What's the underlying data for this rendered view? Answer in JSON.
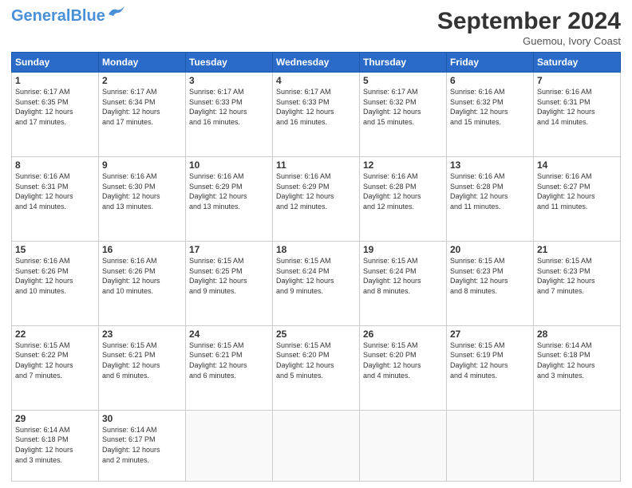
{
  "header": {
    "logo_general": "General",
    "logo_blue": "Blue",
    "month_year": "September 2024",
    "location": "Guemou, Ivory Coast"
  },
  "days_of_week": [
    "Sunday",
    "Monday",
    "Tuesday",
    "Wednesday",
    "Thursday",
    "Friday",
    "Saturday"
  ],
  "weeks": [
    [
      {
        "day": "1",
        "info": "Sunrise: 6:17 AM\nSunset: 6:35 PM\nDaylight: 12 hours\nand 17 minutes."
      },
      {
        "day": "2",
        "info": "Sunrise: 6:17 AM\nSunset: 6:34 PM\nDaylight: 12 hours\nand 17 minutes."
      },
      {
        "day": "3",
        "info": "Sunrise: 6:17 AM\nSunset: 6:33 PM\nDaylight: 12 hours\nand 16 minutes."
      },
      {
        "day": "4",
        "info": "Sunrise: 6:17 AM\nSunset: 6:33 PM\nDaylight: 12 hours\nand 16 minutes."
      },
      {
        "day": "5",
        "info": "Sunrise: 6:17 AM\nSunset: 6:32 PM\nDaylight: 12 hours\nand 15 minutes."
      },
      {
        "day": "6",
        "info": "Sunrise: 6:16 AM\nSunset: 6:32 PM\nDaylight: 12 hours\nand 15 minutes."
      },
      {
        "day": "7",
        "info": "Sunrise: 6:16 AM\nSunset: 6:31 PM\nDaylight: 12 hours\nand 14 minutes."
      }
    ],
    [
      {
        "day": "8",
        "info": "Sunrise: 6:16 AM\nSunset: 6:31 PM\nDaylight: 12 hours\nand 14 minutes."
      },
      {
        "day": "9",
        "info": "Sunrise: 6:16 AM\nSunset: 6:30 PM\nDaylight: 12 hours\nand 13 minutes."
      },
      {
        "day": "10",
        "info": "Sunrise: 6:16 AM\nSunset: 6:29 PM\nDaylight: 12 hours\nand 13 minutes."
      },
      {
        "day": "11",
        "info": "Sunrise: 6:16 AM\nSunset: 6:29 PM\nDaylight: 12 hours\nand 12 minutes."
      },
      {
        "day": "12",
        "info": "Sunrise: 6:16 AM\nSunset: 6:28 PM\nDaylight: 12 hours\nand 12 minutes."
      },
      {
        "day": "13",
        "info": "Sunrise: 6:16 AM\nSunset: 6:28 PM\nDaylight: 12 hours\nand 11 minutes."
      },
      {
        "day": "14",
        "info": "Sunrise: 6:16 AM\nSunset: 6:27 PM\nDaylight: 12 hours\nand 11 minutes."
      }
    ],
    [
      {
        "day": "15",
        "info": "Sunrise: 6:16 AM\nSunset: 6:26 PM\nDaylight: 12 hours\nand 10 minutes."
      },
      {
        "day": "16",
        "info": "Sunrise: 6:16 AM\nSunset: 6:26 PM\nDaylight: 12 hours\nand 10 minutes."
      },
      {
        "day": "17",
        "info": "Sunrise: 6:15 AM\nSunset: 6:25 PM\nDaylight: 12 hours\nand 9 minutes."
      },
      {
        "day": "18",
        "info": "Sunrise: 6:15 AM\nSunset: 6:24 PM\nDaylight: 12 hours\nand 9 minutes."
      },
      {
        "day": "19",
        "info": "Sunrise: 6:15 AM\nSunset: 6:24 PM\nDaylight: 12 hours\nand 8 minutes."
      },
      {
        "day": "20",
        "info": "Sunrise: 6:15 AM\nSunset: 6:23 PM\nDaylight: 12 hours\nand 8 minutes."
      },
      {
        "day": "21",
        "info": "Sunrise: 6:15 AM\nSunset: 6:23 PM\nDaylight: 12 hours\nand 7 minutes."
      }
    ],
    [
      {
        "day": "22",
        "info": "Sunrise: 6:15 AM\nSunset: 6:22 PM\nDaylight: 12 hours\nand 7 minutes."
      },
      {
        "day": "23",
        "info": "Sunrise: 6:15 AM\nSunset: 6:21 PM\nDaylight: 12 hours\nand 6 minutes."
      },
      {
        "day": "24",
        "info": "Sunrise: 6:15 AM\nSunset: 6:21 PM\nDaylight: 12 hours\nand 6 minutes."
      },
      {
        "day": "25",
        "info": "Sunrise: 6:15 AM\nSunset: 6:20 PM\nDaylight: 12 hours\nand 5 minutes."
      },
      {
        "day": "26",
        "info": "Sunrise: 6:15 AM\nSunset: 6:20 PM\nDaylight: 12 hours\nand 4 minutes."
      },
      {
        "day": "27",
        "info": "Sunrise: 6:15 AM\nSunset: 6:19 PM\nDaylight: 12 hours\nand 4 minutes."
      },
      {
        "day": "28",
        "info": "Sunrise: 6:14 AM\nSunset: 6:18 PM\nDaylight: 12 hours\nand 3 minutes."
      }
    ],
    [
      {
        "day": "29",
        "info": "Sunrise: 6:14 AM\nSunset: 6:18 PM\nDaylight: 12 hours\nand 3 minutes."
      },
      {
        "day": "30",
        "info": "Sunrise: 6:14 AM\nSunset: 6:17 PM\nDaylight: 12 hours\nand 2 minutes."
      },
      {
        "day": "",
        "info": ""
      },
      {
        "day": "",
        "info": ""
      },
      {
        "day": "",
        "info": ""
      },
      {
        "day": "",
        "info": ""
      },
      {
        "day": "",
        "info": ""
      }
    ]
  ]
}
